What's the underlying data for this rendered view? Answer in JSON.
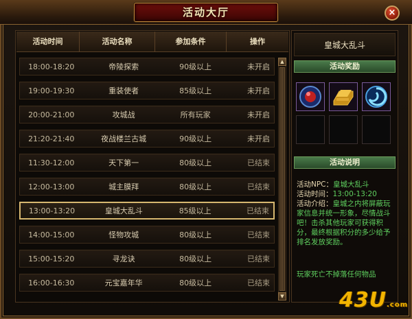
{
  "window": {
    "title": "活动大厅",
    "close_label": "×"
  },
  "table": {
    "headers": [
      "活动时间",
      "活动名称",
      "参加条件",
      "操作"
    ],
    "rows": [
      {
        "time": "18:00-18:20",
        "name": "帝陵探索",
        "cond": "90级以上",
        "op": "未开启"
      },
      {
        "time": "19:00-19:30",
        "name": "重装使者",
        "cond": "85级以上",
        "op": "未开启"
      },
      {
        "time": "20:00-21:00",
        "name": "攻城战",
        "cond": "所有玩家",
        "op": "未开启"
      },
      {
        "time": "21:20-21:40",
        "name": "夜战楼兰古城",
        "cond": "90级以上",
        "op": "未开启"
      },
      {
        "time": "11:30-12:00",
        "name": "天下第一",
        "cond": "80级以上",
        "op": "已结束"
      },
      {
        "time": "12:00-13:00",
        "name": "城主膜拜",
        "cond": "80级以上",
        "op": "已结束"
      },
      {
        "time": "13:00-13:20",
        "name": "皇城大乱斗",
        "cond": "85级以上",
        "op": "已结束"
      },
      {
        "time": "14:00-15:00",
        "name": "怪物攻城",
        "cond": "80级以上",
        "op": "已结束"
      },
      {
        "time": "15:00-15:20",
        "name": "寻龙诀",
        "cond": "80级以上",
        "op": "已结束"
      },
      {
        "time": "16:00-16:30",
        "name": "元宝嘉年华",
        "cond": "80级以上",
        "op": "已结束"
      }
    ],
    "selected_index": 6
  },
  "detail": {
    "title": "皇城大乱斗",
    "rewards_header": "活动奖励",
    "description_header": "活动说明",
    "npc_label": "活动NPC：",
    "npc_value": "皇城大乱斗",
    "time_label": "活动时间：",
    "time_value": "13:00-13:20",
    "intro_label": "活动介绍：",
    "intro_text_1": "皇城之内将屏蔽玩家信息并统一形象，",
    "intro_text_2": "尽情战斗吧！",
    "intro_text_3": "击杀其他玩家可获得积分，最终根据积分的多少给予排名发放奖励。",
    "footnote": "玩家死亡不掉落任何物品"
  },
  "rewards": [
    {
      "icon": "red-orb-icon"
    },
    {
      "icon": "gold-ingot-icon"
    },
    {
      "icon": "blue-swirl-orb-icon"
    },
    {
      "icon": "empty-slot"
    },
    {
      "icon": "empty-slot"
    },
    {
      "icon": "empty-slot"
    }
  ],
  "logo": {
    "text": "43U",
    "suffix": ".com"
  },
  "colors": {
    "accent_green": "#5fd05f",
    "selected_border": "#d8b870"
  }
}
